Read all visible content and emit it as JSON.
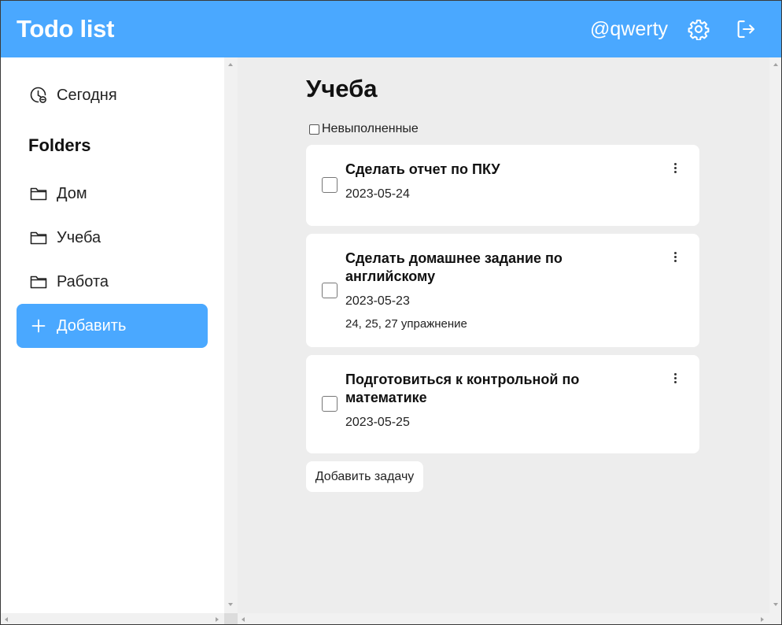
{
  "header": {
    "title": "Todo list",
    "username": "@qwerty",
    "settings_icon": "gear-icon",
    "logout_icon": "logout-icon"
  },
  "sidebar": {
    "today": {
      "label": "Сегодня",
      "icon": "clock-icon"
    },
    "folders_heading": "Folders",
    "folders": [
      {
        "label": "Дом",
        "icon": "folder-icon"
      },
      {
        "label": "Учеба",
        "icon": "folder-icon"
      },
      {
        "label": "Работа",
        "icon": "folder-icon"
      }
    ],
    "add_label": "Добавить",
    "add_icon": "plus-icon"
  },
  "main": {
    "title": "Учеба",
    "filter_label": "Невыполненные",
    "tasks": [
      {
        "title": "Сделать отчет по ПКУ",
        "date": "2023-05-24",
        "note": ""
      },
      {
        "title": "Сделать домашнее задание по английскому",
        "date": "2023-05-23",
        "note": "24, 25, 27 упражнение"
      },
      {
        "title": "Подготовиться к контрольной по математике",
        "date": "2023-05-25",
        "note": ""
      }
    ],
    "add_task_label": "Добавить задачу"
  },
  "colors": {
    "accent": "#4aa8ff",
    "main_bg": "#ededed",
    "card_bg": "#ffffff"
  }
}
